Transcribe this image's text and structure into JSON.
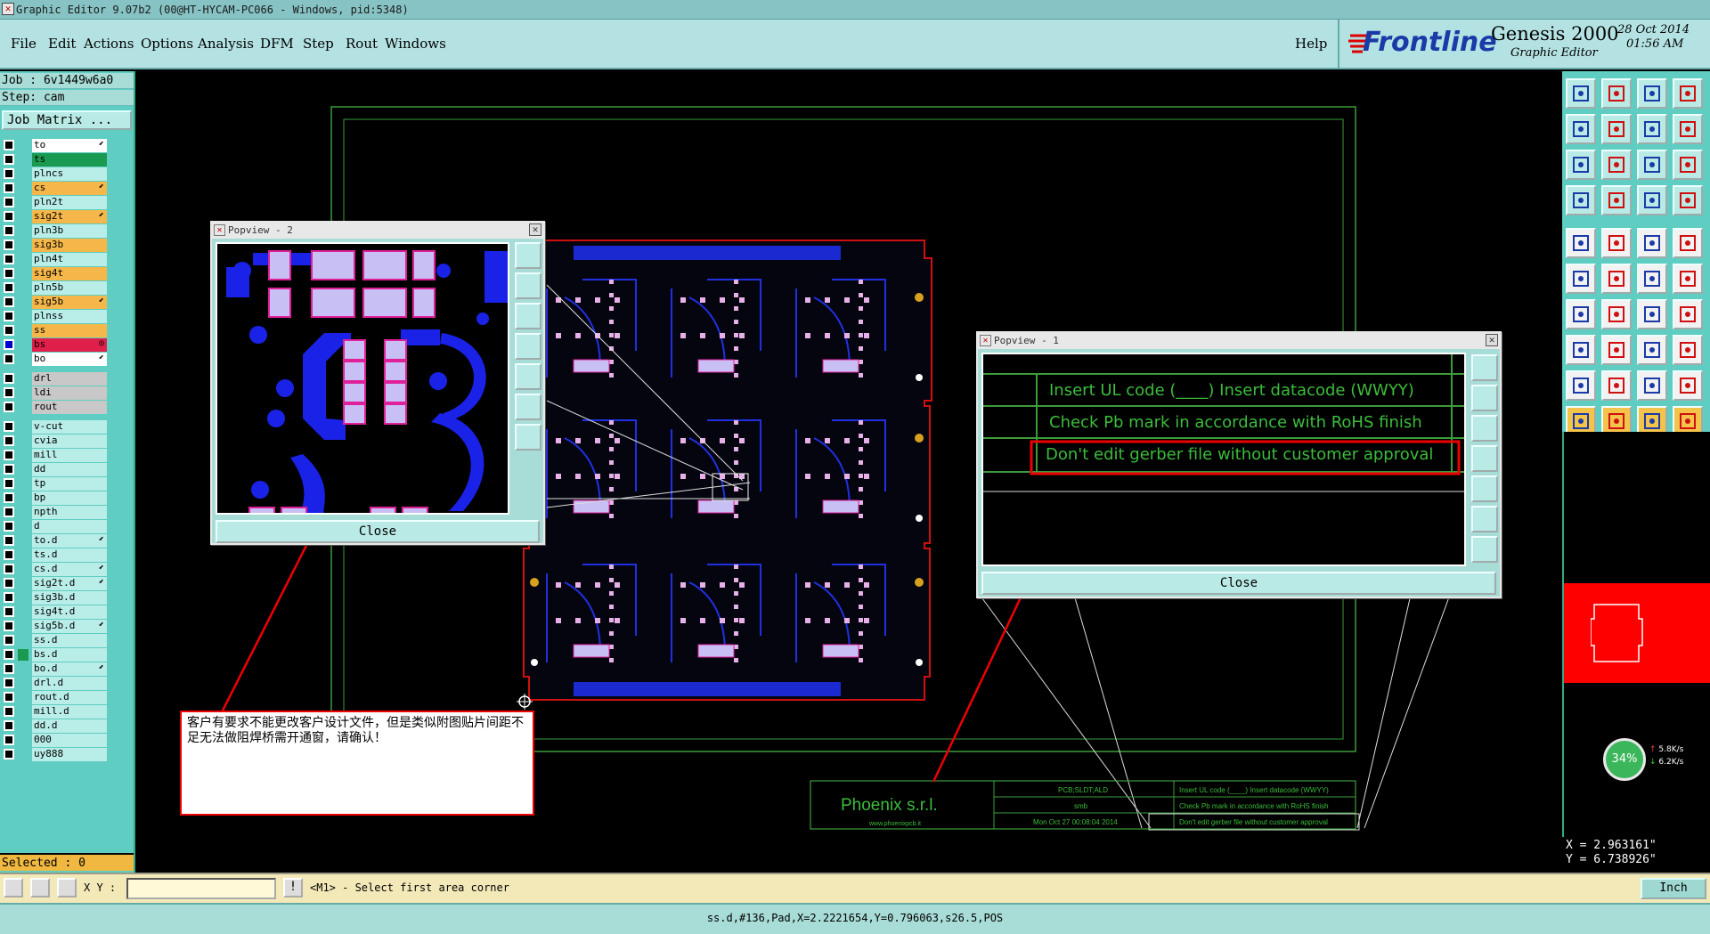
{
  "window": {
    "title": "Graphic Editor 9.07b2 (00@HT-HYCAM-PC066 - Windows, pid:5348)"
  },
  "menu": [
    "File",
    "Edit",
    "Actions",
    "Options",
    "Analysis",
    "DFM",
    "Step",
    "Rout",
    "Windows"
  ],
  "help_label": "Help",
  "brand": {
    "logo": "Frontline",
    "product": "Genesis 2000",
    "subtitle": "Graphic Editor",
    "date": "28 Oct 2014",
    "time": "01:56 AM"
  },
  "job": {
    "job_line": "Job : 6v1449w6a0",
    "step_line": "Step: cam",
    "matrix_label": "Job Matrix ..."
  },
  "layers": [
    {
      "name": "to",
      "color": "#ffffff",
      "flag": "⬋"
    },
    {
      "name": "ts",
      "color": "#1a9a50",
      "flag": ""
    },
    {
      "name": "plncs",
      "color": "#b9ede8",
      "flag": ""
    },
    {
      "name": "cs",
      "color": "#f5b74a",
      "flag": "⬋"
    },
    {
      "name": "pln2t",
      "color": "#b9ede8",
      "flag": ""
    },
    {
      "name": "sig2t",
      "color": "#f5b74a",
      "flag": "⬋"
    },
    {
      "name": "pln3b",
      "color": "#b9ede8",
      "flag": ""
    },
    {
      "name": "sig3b",
      "color": "#f5b74a",
      "flag": ""
    },
    {
      "name": "pln4t",
      "color": "#b9ede8",
      "flag": ""
    },
    {
      "name": "sig4t",
      "color": "#f5b74a",
      "flag": ""
    },
    {
      "name": "pln5b",
      "color": "#b9ede8",
      "flag": ""
    },
    {
      "name": "sig5b",
      "color": "#f5b74a",
      "flag": "⬋"
    },
    {
      "name": "plnss",
      "color": "#b9ede8",
      "flag": ""
    },
    {
      "name": "ss",
      "color": "#f5b74a",
      "flag": ""
    },
    {
      "name": "bs",
      "color": "#e0204a",
      "flag": "◎",
      "selected": true
    },
    {
      "name": "bo",
      "color": "#ffffff",
      "flag": "⬋"
    },
    {
      "name": "drl",
      "color": "#c8c8c8",
      "flag": ""
    },
    {
      "name": "ldi",
      "color": "#c8c8c8",
      "flag": ""
    },
    {
      "name": "rout",
      "color": "#c8c8c8",
      "flag": ""
    },
    {
      "name": "v-cut",
      "color": "#b9ede8",
      "flag": ""
    },
    {
      "name": "cvia",
      "color": "#b9ede8",
      "flag": ""
    },
    {
      "name": "mill",
      "color": "#b9ede8",
      "flag": ""
    },
    {
      "name": "dd",
      "color": "#b9ede8",
      "flag": ""
    },
    {
      "name": "tp",
      "color": "#b9ede8",
      "flag": ""
    },
    {
      "name": "bp",
      "color": "#b9ede8",
      "flag": ""
    },
    {
      "name": "npth",
      "color": "#b9ede8",
      "flag": ""
    },
    {
      "name": "d",
      "color": "#b9ede8",
      "flag": ""
    },
    {
      "name": "to.d",
      "color": "#b9ede8",
      "flag": "⬋"
    },
    {
      "name": "ts.d",
      "color": "#b9ede8",
      "flag": ""
    },
    {
      "name": "cs.d",
      "color": "#b9ede8",
      "flag": "⬋"
    },
    {
      "name": "sig2t.d",
      "color": "#b9ede8",
      "flag": "⬋"
    },
    {
      "name": "sig3b.d",
      "color": "#b9ede8",
      "flag": ""
    },
    {
      "name": "sig4t.d",
      "color": "#b9ede8",
      "flag": ""
    },
    {
      "name": "sig5b.d",
      "color": "#b9ede8",
      "flag": "⬋"
    },
    {
      "name": "ss.d",
      "color": "#b9ede8",
      "flag": ""
    },
    {
      "name": "bs.d",
      "color": "#b9ede8",
      "flag": "",
      "green": true
    },
    {
      "name": "bo.d",
      "color": "#b9ede8",
      "flag": "⬋"
    },
    {
      "name": "drl.d",
      "color": "#b9ede8",
      "flag": ""
    },
    {
      "name": "rout.d",
      "color": "#b9ede8",
      "flag": ""
    },
    {
      "name": "mill.d",
      "color": "#b9ede8",
      "flag": ""
    },
    {
      "name": "dd.d",
      "color": "#b9ede8",
      "flag": ""
    },
    {
      "name": "000",
      "color": "#b9ede8",
      "flag": ""
    },
    {
      "name": "uy888",
      "color": "#b9ede8",
      "flag": ""
    }
  ],
  "selected_label": "Selected : 0",
  "popview2": {
    "title": "Popview - 2",
    "close_label": "Close"
  },
  "popview1": {
    "title": "Popview - 1",
    "close_label": "Close",
    "rows": [
      "Insert UL code (____) Insert datacode (WWYY)",
      "Check Pb mark in accordance with RoHS finish",
      "Don't edit gerber file without customer approval"
    ]
  },
  "annotation_cn": "客户有要求不能更改客户设计文件，但是类似附图贴片间距不足无法做阻焊桥需开通窗，请确认！",
  "title_block": {
    "company": "Phoenix s.r.l.",
    "website": "www.phoenixpcb.it",
    "field1": "PCB;SLDT;ALD",
    "field2": "smb",
    "field3": "Mon Oct 27 00:08:04 2014",
    "note1": "Insert UL code (____) Insert datacode (WWYY)",
    "note2": "Check Pb mark in accordance with RoHS finish",
    "note3": "Don't edit gerber file without customer approval"
  },
  "network": {
    "percent": "34%",
    "up": "5.8K/s",
    "down": "6.2K/s"
  },
  "coords": {
    "x": "X = 2.963161\"",
    "y": "Y = 6.738926\""
  },
  "cmdbar": {
    "xy_label": "X Y :",
    "xy_value": "",
    "message": "<M1> - Select first area corner",
    "units": "Inch"
  },
  "status": "ss.d,#136,Pad,X=2.2221654,Y=0.796063,s26.5,POS",
  "colors": {
    "panel": "#5fcdc1",
    "menubar": "#b4e2e2",
    "highlight_red": "#e00000",
    "board_outline": "#d01010",
    "trace_blue": "#2030e0",
    "pad_pink": "#e8b0e8"
  }
}
